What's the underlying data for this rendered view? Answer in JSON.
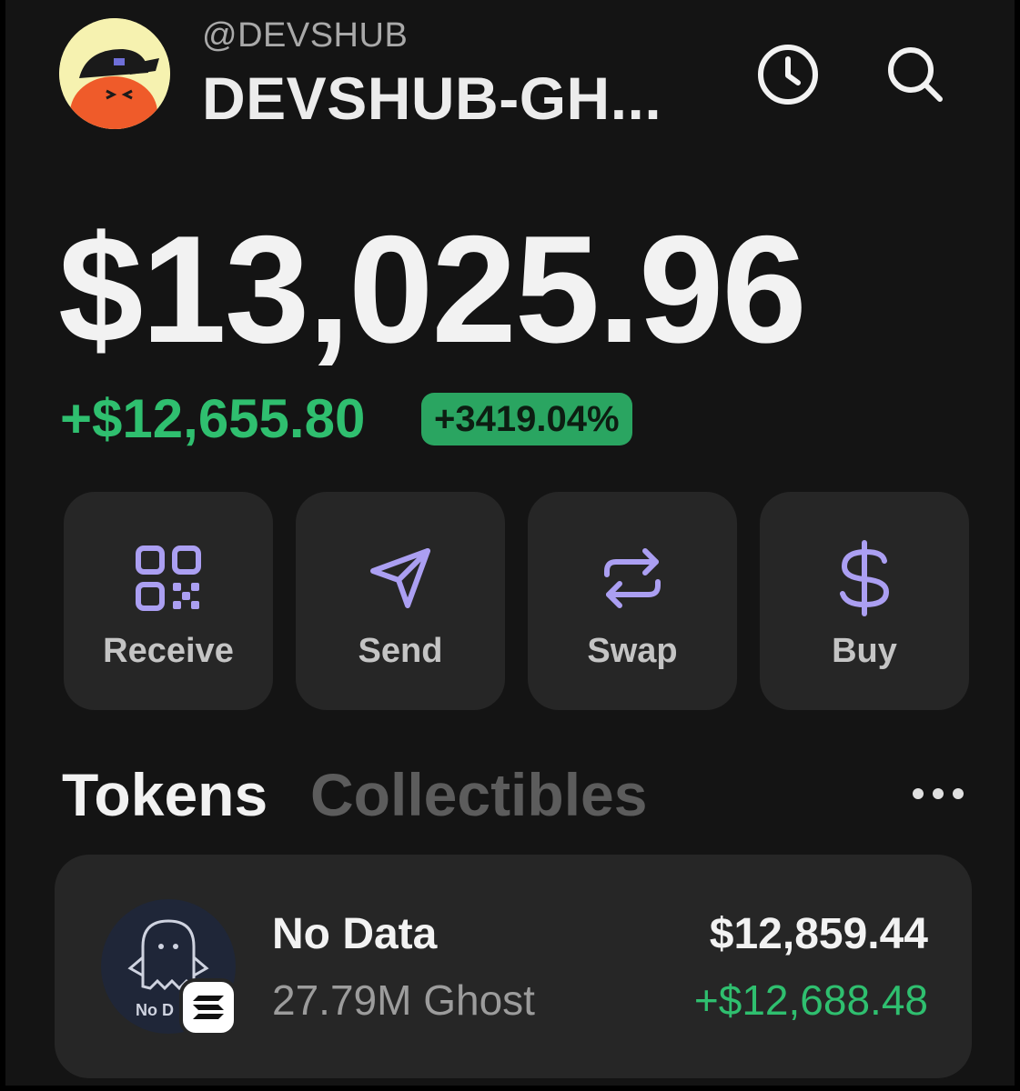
{
  "header": {
    "handle": "@DEVSHUB",
    "account_name": "DEVSHUB-GH..."
  },
  "balance": {
    "total": "$13,025.96",
    "change": "+$12,655.80",
    "change_percent": "+3419.04%"
  },
  "actions": [
    {
      "label": "Receive",
      "icon": "qr-code-icon"
    },
    {
      "label": "Send",
      "icon": "send-icon"
    },
    {
      "label": "Swap",
      "icon": "swap-icon"
    },
    {
      "label": "Buy",
      "icon": "dollar-icon"
    }
  ],
  "tabs": {
    "tokens": "Tokens",
    "collectibles": "Collectibles",
    "active": "Tokens"
  },
  "tokens": [
    {
      "name": "No Data",
      "amount": "27.79M Ghost",
      "value": "$12,859.44",
      "change": "+$12,688.48",
      "logo_text": "No D",
      "chain_icon": "solana-icon"
    }
  ],
  "colors": {
    "background": "#141414",
    "card": "#262626",
    "accent": "#ab9ff2",
    "positive": "#2fbf6f",
    "badge": "#2aa561"
  }
}
